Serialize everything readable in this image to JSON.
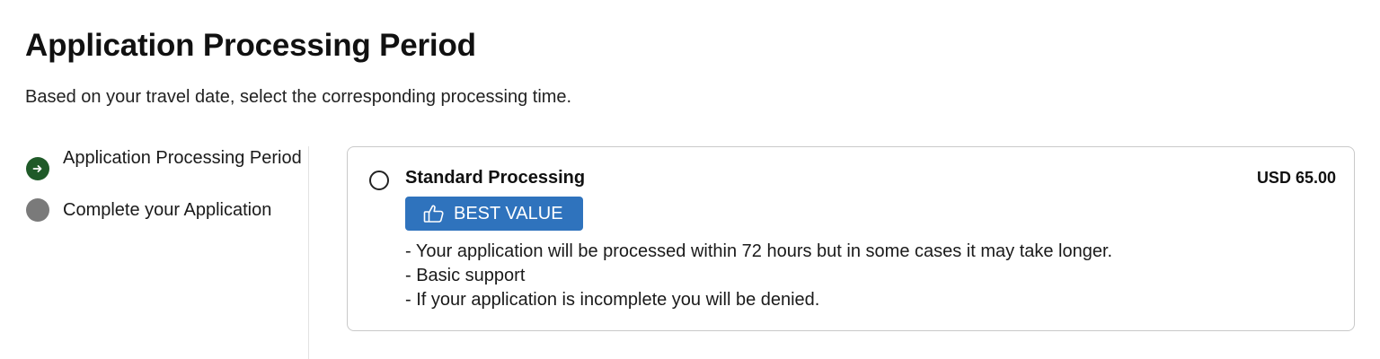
{
  "page": {
    "title": "Application Processing Period",
    "subtitle": "Based on your travel date, select the corresponding processing time."
  },
  "steps": [
    {
      "label": "Application Processing Period",
      "state": "active",
      "icon": "arrow-right-icon"
    },
    {
      "label": "Complete your Application",
      "state": "inactive"
    }
  ],
  "option": {
    "title": "Standard Processing",
    "price": "USD 65.00",
    "selected": false,
    "badge": {
      "label": "BEST VALUE",
      "icon": "thumbs-up-icon"
    },
    "features": [
      "- Your application will be processed within 72 hours but in some cases it may take longer.",
      "- Basic support",
      "- If your application is incomplete you will be denied."
    ]
  },
  "colors": {
    "active_step": "#1f5a28",
    "inactive_step": "#7a7a7a",
    "badge": "#2f73bd",
    "card_border": "#c9c9c9"
  }
}
